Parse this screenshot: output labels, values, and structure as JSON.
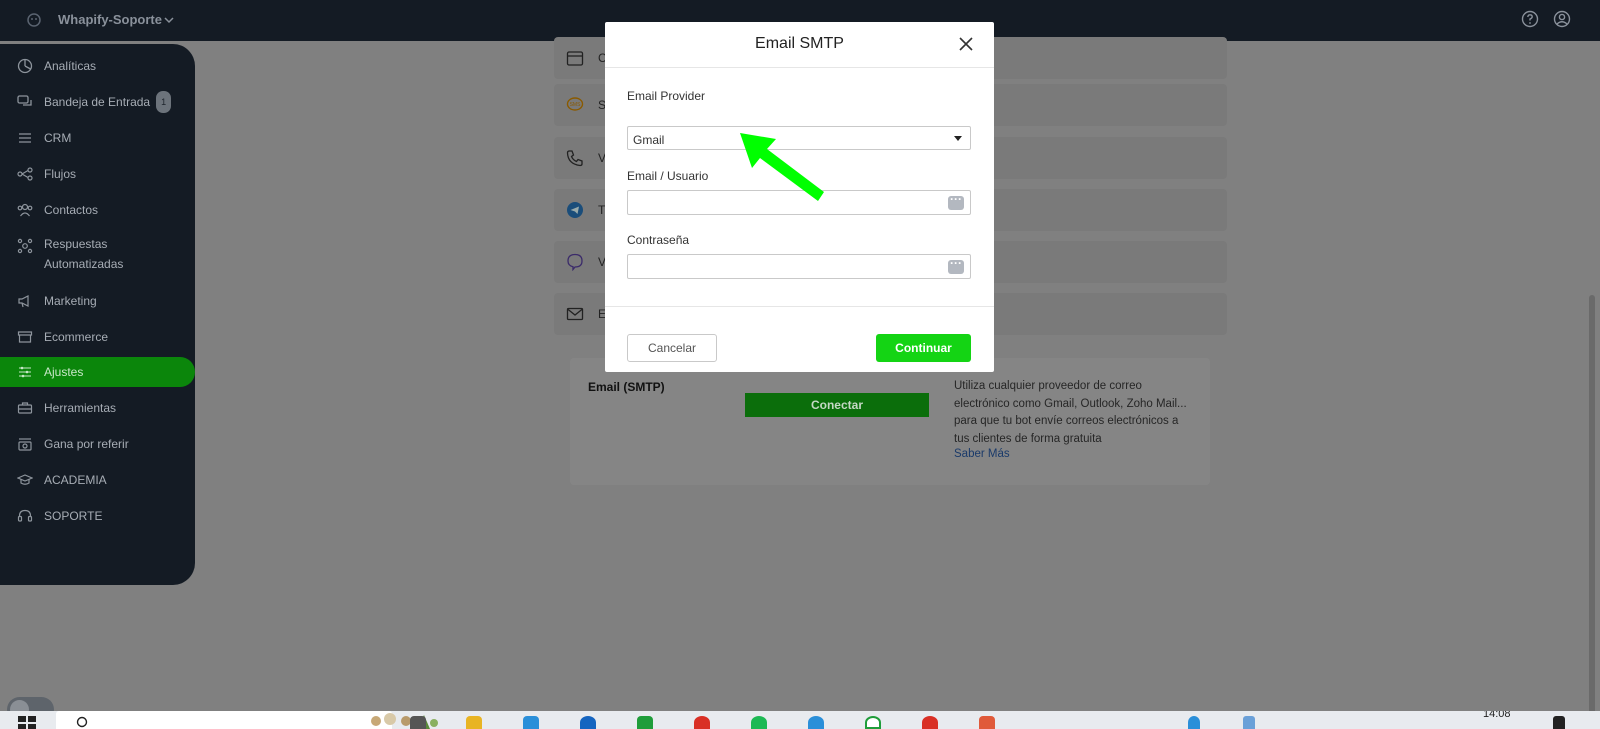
{
  "topbar": {
    "workspace_name": "Whapify-Soporte"
  },
  "sidebar": {
    "items": [
      {
        "label": "Analíticas",
        "icon": "chart-pie-icon"
      },
      {
        "label": "Bandeja de Entrada",
        "icon": "chat-bubbles-icon",
        "badge": "1"
      },
      {
        "label": "CRM",
        "icon": "list-icon"
      },
      {
        "label": "Flujos",
        "icon": "flow-icon"
      },
      {
        "label": "Contactos",
        "icon": "users-icon"
      },
      {
        "label": "Respuestas Automatizadas",
        "icon": "auto-reply-icon"
      },
      {
        "label": "Marketing",
        "icon": "megaphone-icon"
      },
      {
        "label": "Ecommerce",
        "icon": "store-icon"
      },
      {
        "label": "Ajustes",
        "icon": "sliders-icon",
        "active": true
      },
      {
        "label": "Herramientas",
        "icon": "toolbox-icon"
      },
      {
        "label": "Gana por referir",
        "icon": "gift-icon"
      },
      {
        "label": "ACADEMIA",
        "icon": "graduation-cap-icon"
      },
      {
        "label": "SOPORTE",
        "icon": "headset-icon"
      }
    ]
  },
  "channels": [
    {
      "letter": "C",
      "icon": "calendar-icon"
    },
    {
      "letter": "S",
      "icon": "sms-icon"
    },
    {
      "letter": "V",
      "icon": "phone-icon"
    },
    {
      "letter": "T",
      "icon": "telegram-icon"
    },
    {
      "letter": "V",
      "icon": "viber-icon"
    },
    {
      "letter": "E",
      "icon": "envelope-icon"
    }
  ],
  "smtp_card": {
    "title": "Email (SMTP)",
    "button": "Conectar",
    "description": "Utiliza cualquier proveedor de correo electrónico como Gmail, Outlook, Zoho Mail... para que tu bot envíe correos electrónicos a tus clientes de forma gratuita",
    "link": "Saber Más"
  },
  "modal": {
    "title": "Email SMTP",
    "provider_label": "Email Provider",
    "provider_value": "Gmail",
    "user_label": "Email / Usuario",
    "user_value": "",
    "password_label": "Contraseña",
    "password_value": "",
    "cancel_label": "Cancelar",
    "continue_label": "Continuar"
  },
  "taskbar": {
    "clock": "14:08"
  },
  "colors": {
    "accent_green": "#14d414",
    "sidebar_bg": "#141b24",
    "arrow": "#00ff00"
  }
}
